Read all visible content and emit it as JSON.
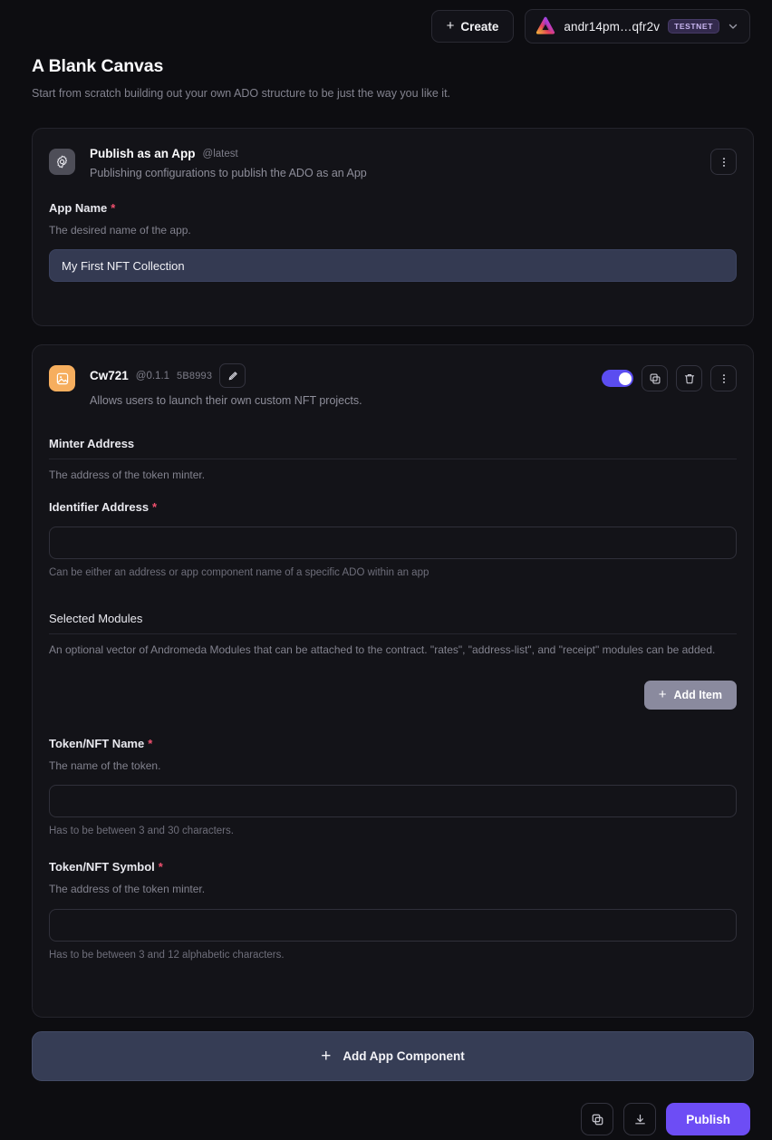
{
  "topbar": {
    "create_label": "Create",
    "plus": "+",
    "wallet_address": "andr14pm…qfr2v",
    "network_badge": "TESTNET",
    "chevron": "⌄"
  },
  "header": {
    "title": "A Blank Canvas",
    "subtitle": "Start from scratch building out your own ADO structure to be just the way you like it."
  },
  "publish_card": {
    "name": "Publish as an App",
    "version": "@latest",
    "description": "Publishing configurations to publish the ADO as an App",
    "icon": "gear-icon",
    "fields": [
      {
        "label": "App Name",
        "required": "*",
        "help": "The desired name of the app.",
        "value": "My First NFT Collection",
        "placeholder": ""
      }
    ]
  },
  "cw721_card": {
    "name": "Cw721",
    "version": "@0.1.1",
    "hash": "5B8993",
    "description": "Allows users to launch their own custom NFT projects.",
    "icon": "image-icon",
    "toggle_on": true,
    "fields": {
      "minter_address": {
        "label": "Minter Address",
        "required": "",
        "help": "The address of the token minter."
      },
      "identifier_address": {
        "label": "Identifier Address",
        "required": "*",
        "value": "",
        "placeholder": "",
        "hint": "Can be either an address or app component name of a specific ADO within an app"
      },
      "selected_modules": {
        "label": "Selected Modules",
        "help": "An optional vector of Andromeda Modules that can be attached to the contract. \"rates\", \"address-list\", and \"receipt\" modules can be added.",
        "add_item_label": "Add Item",
        "add_item_plus": "+"
      },
      "token_name": {
        "label": "Token/NFT Name",
        "required": "*",
        "help": "The name of the token.",
        "value": "",
        "placeholder": "",
        "hint": "Has to be between 3 and 30 characters."
      },
      "token_symbol": {
        "label": "Token/NFT Symbol",
        "required": "*",
        "help": "The address of the token minter.",
        "value": "",
        "placeholder": "",
        "hint": "Has to be between 3 and 12 alphabetic characters."
      }
    }
  },
  "add_component": {
    "label": "Add App Component",
    "plus": "+"
  },
  "footer": {
    "publish_label": "Publish"
  },
  "colors": {
    "accent_purple": "#6d4df5",
    "toggle_on": "#5b4df0",
    "required_red": "#f0506e",
    "cw721_icon": "#f6ae5e",
    "add_component_bg": "#363d55",
    "input_filled_bg": "#343a52"
  }
}
